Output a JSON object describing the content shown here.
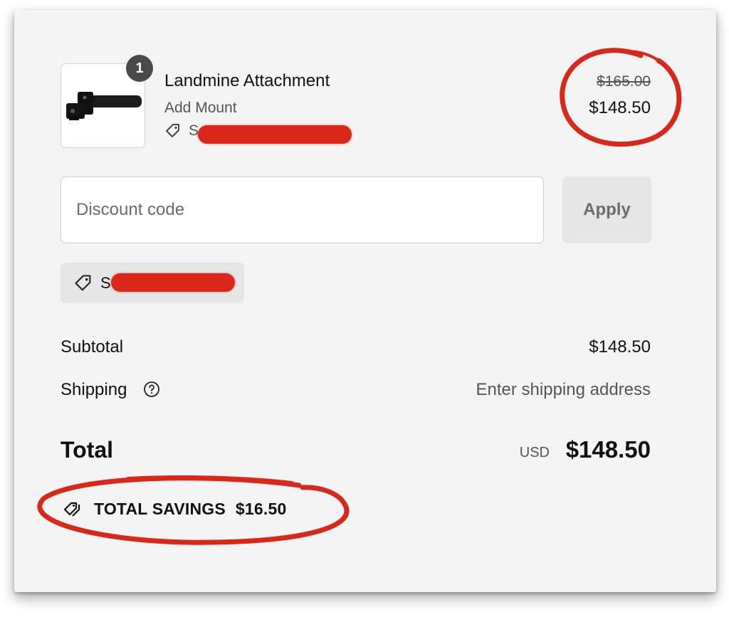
{
  "cart_item": {
    "quantity": "1",
    "name": "Landmine Attachment",
    "variant": "Add Mount",
    "discount_initial": "S",
    "original_price": "$165.00",
    "sale_price": "$148.50",
    "image_icon": "landmine-attachment-product-image",
    "tag_icon": "tag-icon"
  },
  "discount": {
    "placeholder": "Discount code",
    "apply_label": "Apply",
    "applied_code_initial": "S"
  },
  "summary": {
    "subtotal_label": "Subtotal",
    "subtotal_value": "$148.50",
    "shipping_label": "Shipping",
    "shipping_value": "Enter shipping address",
    "total_label": "Total",
    "currency": "USD",
    "total_value": "$148.50",
    "savings_label": "TOTAL SAVINGS",
    "savings_value": "$16.50"
  },
  "colors": {
    "annotation_red": "#d9281a",
    "panel_background": "#f4f4f4",
    "badge": "#4a4a4a"
  }
}
